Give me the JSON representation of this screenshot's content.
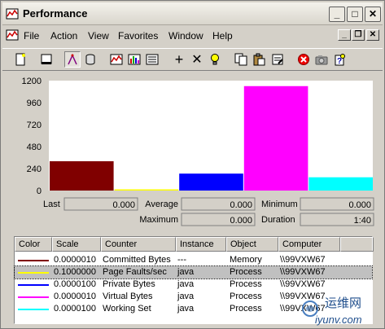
{
  "window": {
    "title": "Performance"
  },
  "menu": {
    "items": [
      "File",
      "Action",
      "View",
      "Favorites",
      "Window",
      "Help"
    ]
  },
  "toolbar": {
    "icons": [
      "new-counter-set-icon",
      "clear-display-icon",
      "view-current-activity-icon",
      "view-log-data-icon",
      "view-graph-icon",
      "view-histogram-icon",
      "view-report-icon",
      "add-icon",
      "delete-icon",
      "highlight-icon",
      "copy-properties-icon",
      "paste-counter-list-icon",
      "properties-icon",
      "freeze-display-icon",
      "update-data-icon",
      "help-icon"
    ]
  },
  "chart_data": {
    "type": "bar",
    "ylim": [
      0,
      1200
    ],
    "y_ticks": [
      "1200",
      "960",
      "720",
      "480",
      "240",
      "0"
    ],
    "categories": [
      "Committed Bytes",
      "Page Faults/sec",
      "Private Bytes",
      "Virtual Bytes",
      "Working Set"
    ],
    "values": [
      320,
      8,
      185,
      1140,
      145
    ],
    "colors": [
      "#800000",
      "#ffff00",
      "#0000ff",
      "#ff00ff",
      "#00ffff"
    ],
    "grid": false
  },
  "stats": {
    "last_label": "Last",
    "last_value": "0.000",
    "average_label": "Average",
    "average_value": "0.000",
    "minimum_label": "Minimum",
    "minimum_value": "0.000",
    "maximum_label": "Maximum",
    "maximum_value": "0.000",
    "duration_label": "Duration",
    "duration_value": "1:40"
  },
  "legend": {
    "columns": [
      "Color",
      "Scale",
      "Counter",
      "Instance",
      "Object",
      "Computer"
    ],
    "rows": [
      {
        "color": "#800000",
        "scale": "0.0000010",
        "counter": "Committed Bytes",
        "instance": "---",
        "object": "Memory",
        "computer": "\\\\99VXW67"
      },
      {
        "color": "#ffff00",
        "scale": "0.1000000",
        "counter": "Page Faults/sec",
        "instance": "java",
        "object": "Process",
        "computer": "\\\\99VXW67"
      },
      {
        "color": "#0000ff",
        "scale": "0.0000100",
        "counter": "Private Bytes",
        "instance": "java",
        "object": "Process",
        "computer": "\\\\99VXW67"
      },
      {
        "color": "#ff00ff",
        "scale": "0.0000010",
        "counter": "Virtual Bytes",
        "instance": "java",
        "object": "Process",
        "computer": "\\\\99VXW67"
      },
      {
        "color": "#00ffff",
        "scale": "0.0000100",
        "counter": "Working Set",
        "instance": "java",
        "object": "Process",
        "computer": "\\\\99VXW67"
      }
    ]
  },
  "watermark": {
    "line1": "运维网",
    "line2": "iyunv.com"
  }
}
